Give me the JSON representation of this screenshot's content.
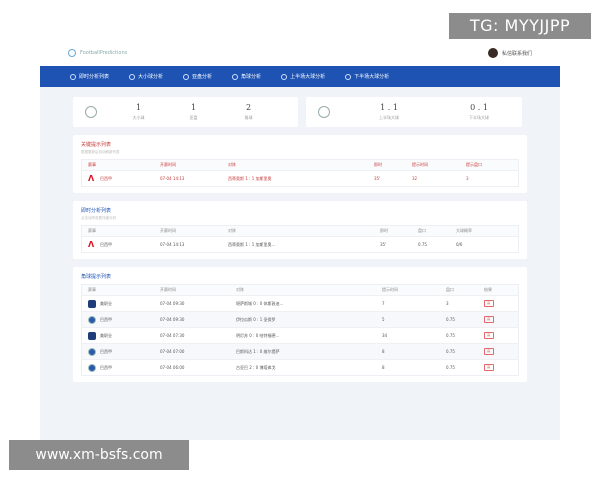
{
  "watermarks": {
    "tg": "TG: MYYJJPP",
    "url": "www.xm-bsfs.com"
  },
  "header": {
    "brand": "FootballPredictions",
    "user_name": "私信联系我们"
  },
  "nav": {
    "tabs": [
      {
        "label": "即时分析列表",
        "icon": "clock-icon"
      },
      {
        "label": "大小球分析",
        "icon": "ball-icon"
      },
      {
        "label": "亚盘分析",
        "icon": "chart-icon"
      },
      {
        "label": "角球分析",
        "icon": "flag-icon"
      },
      {
        "label": "上半场大球分析",
        "icon": "half-icon"
      },
      {
        "label": "下半场大球分析",
        "icon": "half-icon"
      }
    ]
  },
  "stats": {
    "left": [
      {
        "value": "1",
        "label": "大小球"
      },
      {
        "value": "1",
        "label": "亚盘"
      },
      {
        "value": "2",
        "label": "角球"
      }
    ],
    "right": [
      {
        "value": "1 . 1",
        "label": "上半场大球"
      },
      {
        "value": "0 . 1",
        "label": "下半场大球"
      }
    ]
  },
  "panel_hot": {
    "title": "关键提示列表",
    "subtitle": "数据更新后自动刷新列表",
    "headers": [
      "赛事",
      "开赛时间",
      "对阵",
      "即时",
      "提示时间",
      "提示盘口"
    ],
    "rows": [
      {
        "league": "巴西甲",
        "time": "07-04 14:13",
        "match": "西蒂奥斯  1 : 1  加斯里奥",
        "now": "35'",
        "hint_time": "32",
        "hint": "3"
      }
    ]
  },
  "panel_live": {
    "title": "即时分析列表",
    "subtitle": "点击对阵查看详细分析",
    "headers": [
      "赛事",
      "开赛时间",
      "对阵",
      "即时",
      "盘口",
      "大球概率"
    ],
    "rows": [
      {
        "league": "巴西甲",
        "time": "07-04 14:13",
        "match": "西蒂奥斯  1 : 1  加斯里奥...",
        "now": "35'",
        "line": "0.75",
        "prob": "0/6"
      }
    ]
  },
  "panel_corner": {
    "title": "角球提示列表",
    "headers": [
      "赛事",
      "开赛时间",
      "对阵",
      "提示时间",
      "盘口",
      "结果"
    ],
    "rows": [
      {
        "league": "美职业",
        "badge": "crest",
        "time": "07-04 09:30",
        "match": "堪萨斯城  0 : 0  休斯敦迪...",
        "hint_time": "7",
        "line": "3",
        "result": "赢"
      },
      {
        "league": "巴西甲",
        "badge": "shield",
        "time": "07-04 09:30",
        "match": "伊拉瓜斯  0 : 1  圣保罗",
        "hint_time": "5",
        "line": "0.75",
        "result": "赢"
      },
      {
        "league": "美职业",
        "badge": "crest",
        "time": "07-04 07:30",
        "match": "明尼苏  0 : 0  哈特福德...",
        "hint_time": "34",
        "line": "0.75",
        "result": "赢"
      },
      {
        "league": "巴西甲",
        "badge": "shield",
        "time": "07-04 07:00",
        "match": "巴斯科达  1 : 0  维尔提萨",
        "hint_time": "8",
        "line": "0.75",
        "result": "赢"
      },
      {
        "league": "巴西甲",
        "badge": "shield",
        "time": "07-04 06:00",
        "match": "古亚巴  2 : 0  博塔弗戈",
        "hint_time": "8",
        "line": "0.75",
        "result": "赢"
      }
    ]
  }
}
